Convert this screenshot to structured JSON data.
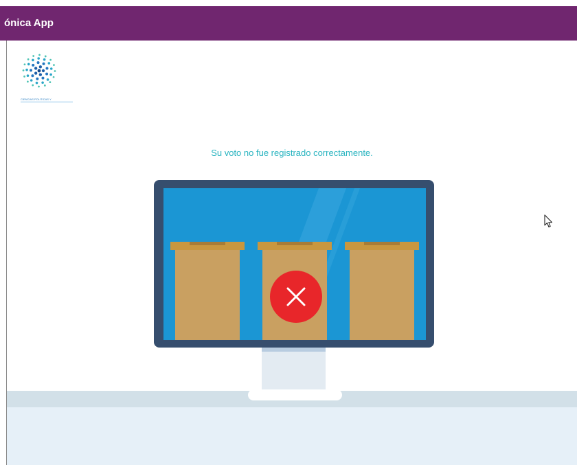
{
  "window": {
    "title": "ónica App",
    "titlebar_color": "#70266f"
  },
  "logo": {
    "name": "dotted-circle-logo",
    "caption": "CIENCIAS POLITICAS Y"
  },
  "status": {
    "message": "Su voto no fue registrado correctamente.",
    "message_color": "#29b4c0",
    "result": "error"
  },
  "illustration": {
    "name": "monitor-ballot-boxes",
    "box_count": 3,
    "error_icon": "x-circle-icon",
    "error_color": "#e8262a"
  },
  "cursor": {
    "icon": "arrow-cursor-icon"
  }
}
